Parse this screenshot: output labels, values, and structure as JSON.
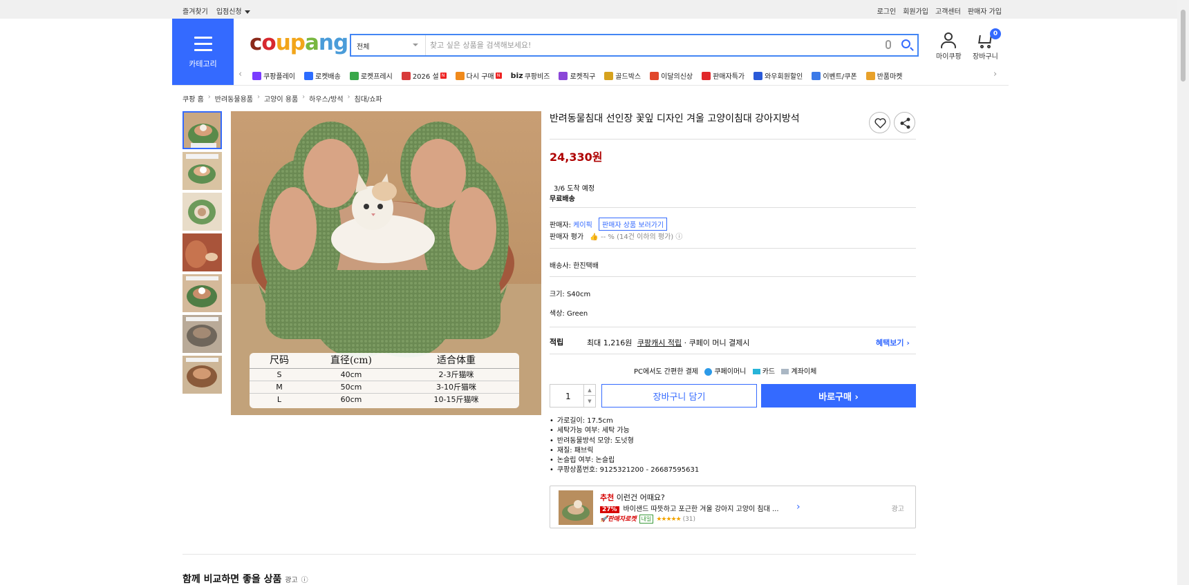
{
  "topbar": {
    "left": [
      "즐겨찾기",
      "입점신청"
    ],
    "right": [
      "로그인",
      "회원가입",
      "고객센터",
      "판매자 가입"
    ]
  },
  "header": {
    "category_label": "카테고리",
    "logo": [
      "c",
      "o",
      "u",
      "p",
      "a",
      "n",
      "g"
    ],
    "search_select": "전체",
    "search_placeholder": "찾고 싶은 상품을 검색해보세요!",
    "mycoupang": "마이쿠팡",
    "cart": "장바구니",
    "cart_count": "0"
  },
  "nav": {
    "items": [
      {
        "label": "쿠팡플레이",
        "color": "#7a3cff"
      },
      {
        "label": "로켓배송",
        "color": "#2c6cff"
      },
      {
        "label": "로켓프레시",
        "color": "#39a84a"
      },
      {
        "label": "2026 설",
        "color": "#d83a3a",
        "badge": "N"
      },
      {
        "label": "다시 구매",
        "color": "#f08a1c",
        "badge": "N"
      },
      {
        "label": "쿠팡비즈",
        "color": "#222222",
        "prefix": "biz"
      },
      {
        "label": "로켓직구",
        "color": "#8a46d8"
      },
      {
        "label": "골드박스",
        "color": "#d6a21e"
      },
      {
        "label": "이달의신상",
        "color": "#e1472b"
      },
      {
        "label": "판매자특가",
        "color": "#e1282b"
      },
      {
        "label": "와우회원할인",
        "color": "#2a5ad8"
      },
      {
        "label": "이벤트/쿠폰",
        "color": "#3c7ae8"
      },
      {
        "label": "반품마켓",
        "color": "#e8a12a"
      }
    ]
  },
  "breadcrumb": [
    "쿠팡 홈",
    "반려동물용품",
    "고양이 용품",
    "하우스/방석",
    "침대/쇼파"
  ],
  "product": {
    "title": "반려동물침대 선인장 꽃잎 디자인 겨울 고양이침대 강아지방석",
    "price": "24,330원",
    "arrival": "3/6 도착 예정",
    "shipping": "무료배송",
    "seller_label": "판매자:",
    "seller_name": "케이픽",
    "seller_link": "판매자 상품 보러가기",
    "rating_label": "판매자 평가",
    "rating_value": "-- % (14건 이하의 평가)",
    "carrier": "배송사:  한진택배",
    "size": "크기: S40cm",
    "color": "색상: Green",
    "reward_title": "적립",
    "reward_text": "최대 1,216원",
    "reward_link": "쿠팡캐시 적립",
    "reward_tail": "· 쿠페이 머니 결제시",
    "benefit_link": "혜택보기",
    "pay_title": "PC에서도 간편한 결제",
    "pay_options": [
      "쿠페이머니",
      "카드",
      "계좌이체"
    ],
    "qty": "1",
    "add_cart": "장바구니 담기",
    "buy_now": "바로구매",
    "bullets": [
      "가로길이: 17.5cm",
      "세탁가능 여부: 세탁 가능",
      "반려동물방석 모양: 도넛형",
      "재질: 패브릭",
      "논슬립 여부: 논슬립",
      "쿠팡상품번호: 9125321200 - 26687595631"
    ],
    "size_table": {
      "headers": [
        "尺码",
        "直径(cm)",
        "适合体重"
      ],
      "rows": [
        [
          "S",
          "40cm",
          "2-3斤猫咪"
        ],
        [
          "M",
          "50cm",
          "3-10斤猫咪"
        ],
        [
          "L",
          "60cm",
          "10-15斤猫咪"
        ]
      ]
    }
  },
  "recommend": {
    "label_red": "추천",
    "label": "이런건 어때요?",
    "discount": "27%",
    "name": "바이샌드 따뜻하고 포근한 겨울 강아지 고양이 침대 ...",
    "rocket": "🚀판매자로켓",
    "tomorrow": "내일",
    "stars": "★★★★★",
    "reviews": "(31)",
    "ad": "광고"
  },
  "compare": {
    "title": "함께 비교하면 좋을 상품",
    "ad": "광고"
  }
}
